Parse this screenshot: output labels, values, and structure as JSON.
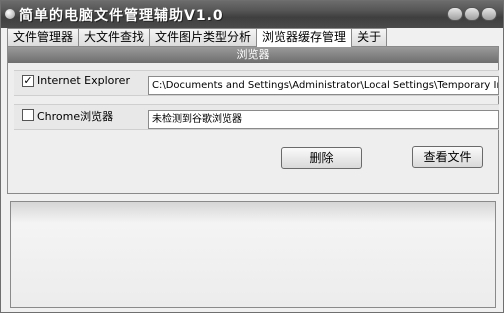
{
  "window": {
    "title": "简单的电脑文件管理辅助V1.0",
    "buttons": [
      "minimize",
      "maximize",
      "close"
    ]
  },
  "tabs": [
    {
      "label": "文件管理器",
      "active": false
    },
    {
      "label": "大文件查找",
      "active": false
    },
    {
      "label": "文件图片类型分析",
      "active": false
    },
    {
      "label": "浏览器缓存管理",
      "active": true
    },
    {
      "label": "关于",
      "active": false
    }
  ],
  "panel": {
    "header": "浏览器",
    "browsers": [
      {
        "label": "Internet Explorer",
        "checked": true,
        "check_glyph": "✓",
        "path": "C:\\Documents and Settings\\Administrator\\Local Settings\\Temporary Internet Files"
      },
      {
        "label": "Chrome浏览器",
        "checked": false,
        "check_glyph": "",
        "path": "未检测到谷歌浏览器"
      }
    ],
    "delete_label": "删除",
    "view_label": "查看文件"
  },
  "colors": {
    "titlebar": "#4a4a4a",
    "panel_header": "#808080",
    "window_bg": "#f0f0f0"
  }
}
